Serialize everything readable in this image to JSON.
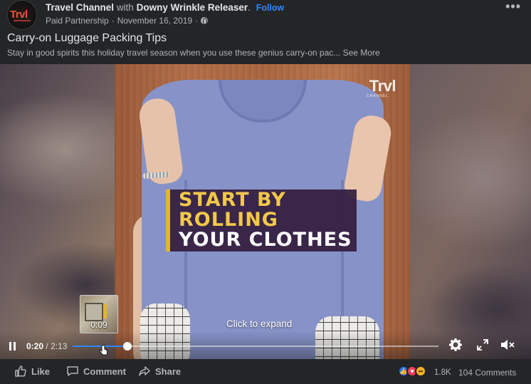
{
  "post": {
    "author": "Travel Channel",
    "with_word": "with",
    "partner": "Downy Wrinkle Releaser",
    "partner_suffix": ".",
    "follow_label": "Follow",
    "sponsor_label": "Paid Partnership",
    "separator": "·",
    "date": "November 16, 2019",
    "privacy_icon": "globe-icon",
    "more_icon": "more-options-icon",
    "more_glyph": "•••",
    "title": "Carry-on Luggage Packing Tips",
    "description": "Stay in good spirits this holiday travel season when you use these genius carry-on pac...",
    "see_more_label": "See More",
    "avatar_logo": "Trvl"
  },
  "video": {
    "watermark": "Trvl",
    "watermark_sub": "CHANNEL",
    "caption_lines": [
      "START BY",
      "ROLLING",
      "YOUR CLOTHES"
    ],
    "click_to_expand": "Click to expand",
    "preview_time": "0:09",
    "current_time": "0:20",
    "time_separator": "/",
    "total_time": "2:13",
    "progress_fraction": 0.15,
    "accent_color": "#2d88ff",
    "caption_accent": "#e3b52d"
  },
  "actions": {
    "like_label": "Like",
    "comment_label": "Comment",
    "share_label": "Share"
  },
  "reactions": {
    "types": [
      "like",
      "love",
      "wow"
    ],
    "count": "1.8K",
    "comments": "104 Comments"
  }
}
